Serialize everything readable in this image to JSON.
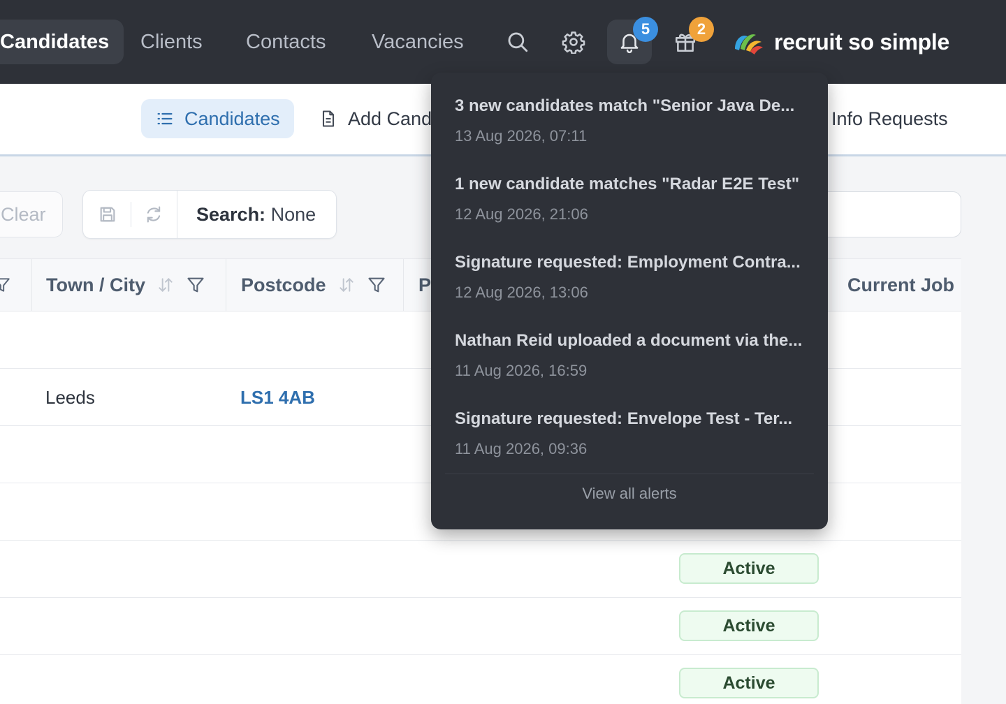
{
  "nav": {
    "items": [
      {
        "label": "Candidates",
        "active": true
      },
      {
        "label": "Clients",
        "active": false
      },
      {
        "label": "Contacts",
        "active": false
      },
      {
        "label": "Vacancies",
        "active": false
      }
    ],
    "icons": [
      "search-icon",
      "gear-icon",
      "bell-icon",
      "gift-icon"
    ],
    "notifications_badge": "5",
    "gifts_badge": "2",
    "brand_name": "recruit so simple"
  },
  "subnav": {
    "tabs": [
      {
        "label": "Candidates",
        "icon": "list-icon",
        "active": true
      },
      {
        "label": "Add Cand",
        "icon": "document-icon",
        "active": false
      },
      {
        "label": "Info Requests",
        "active": false
      }
    ]
  },
  "filters": {
    "clear_label": "Clear",
    "search_label": "Search:",
    "search_value": "None",
    "search_input_value": ""
  },
  "table": {
    "columns": [
      {
        "label": "Town / City",
        "sortable": true,
        "filterable": true
      },
      {
        "label": "Postcode",
        "sortable": true,
        "filterable": true
      },
      {
        "label": "P",
        "sortable": false,
        "filterable": false
      },
      {
        "label": "Current Job",
        "sortable": false,
        "filterable": false
      }
    ],
    "rows": [
      {
        "town": "",
        "postcode": "",
        "status": ""
      },
      {
        "town": "Leeds",
        "postcode": "LS1 4AB",
        "status": ""
      },
      {
        "town": "",
        "postcode": "",
        "status": ""
      },
      {
        "town": "",
        "postcode": "",
        "status": ""
      },
      {
        "town": "",
        "postcode": "",
        "status": "Active"
      },
      {
        "town": "",
        "postcode": "",
        "status": "Active"
      },
      {
        "town": "",
        "postcode": "",
        "status": "Active"
      }
    ]
  },
  "alerts": {
    "items": [
      {
        "title": "3 new candidates match \"Senior Java De...",
        "time": "13 Aug 2026, 07:11"
      },
      {
        "title": "1 new candidate matches \"Radar E2E Test\"",
        "time": "12 Aug 2026, 21:06"
      },
      {
        "title": "Signature requested: Employment Contra...",
        "time": "12 Aug 2026, 13:06"
      },
      {
        "title": "Nathan Reid uploaded a document via the...",
        "time": "11 Aug 2026, 16:59"
      },
      {
        "title": "Signature requested: Envelope Test - Ter...",
        "time": "11 Aug 2026, 09:36"
      }
    ],
    "view_all_label": "View all alerts"
  },
  "colors": {
    "topbar": "#2e3138",
    "accent": "#2f6fae",
    "notification_badge": "#3b8fe0",
    "gift_badge": "#f0a23a",
    "status_active_bg": "#eefbf0",
    "status_active_text": "#2b4b31"
  }
}
